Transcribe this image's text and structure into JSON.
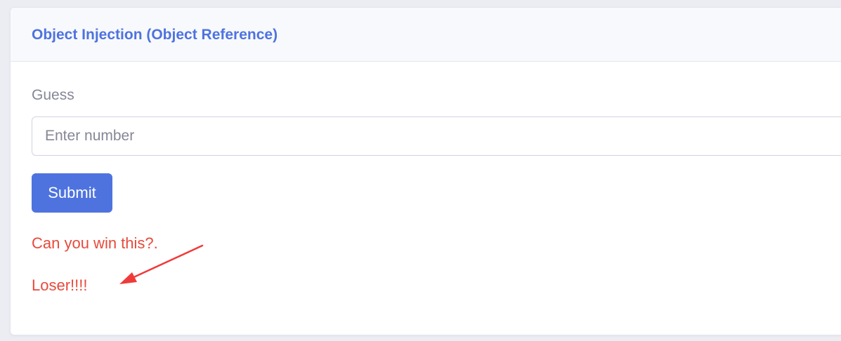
{
  "card": {
    "title": "Object Injection (Object Reference)"
  },
  "form": {
    "label": "Guess",
    "input_placeholder": "Enter number",
    "input_value": "",
    "submit_label": "Submit"
  },
  "messages": {
    "challenge": "Can you win this?.",
    "result": "Loser!!!!"
  },
  "annotation": {
    "arrow_icon": "red-arrow-icon",
    "color": "#f03a3a"
  },
  "colors": {
    "accent": "#4e73df",
    "error": "#e74a3b",
    "muted": "#858796"
  }
}
